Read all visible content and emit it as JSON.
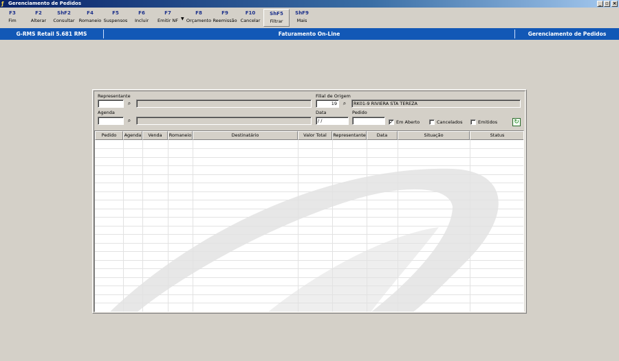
{
  "window": {
    "title": "Gerenciamento de Pedidos",
    "controls": {
      "minimize": "_",
      "maximize": "▫",
      "close": "×"
    }
  },
  "toolbar": {
    "buttons": [
      {
        "key": "F3",
        "label": "Fim"
      },
      {
        "key": "F2",
        "label": "Alterar"
      },
      {
        "key": "ShF2",
        "label": "Consultar"
      },
      {
        "key": "F4",
        "label": "Romaneio"
      },
      {
        "key": "F5",
        "label": "Suspensos"
      },
      {
        "key": "F6",
        "label": "Incluir"
      },
      {
        "key": "F7",
        "label": "Emitir NF"
      },
      {
        "key": "F8",
        "label": "Orçamento"
      },
      {
        "key": "F9",
        "label": "Reemissão"
      },
      {
        "key": "F10",
        "label": "Cancelar"
      },
      {
        "key": "ShF5",
        "label": "Filtrar"
      },
      {
        "key": "ShF9",
        "label": "Mais"
      }
    ]
  },
  "infobar": {
    "system": "G-RMS Retail 5.681 RMS",
    "module": "Faturamento On-Line",
    "screen": "Gerenciamento de Pedidos"
  },
  "filters": {
    "representante": {
      "label": "Representante",
      "code": "",
      "name": ""
    },
    "agenda": {
      "label": "Agenda",
      "code": "",
      "name": ""
    },
    "filial": {
      "label": "Filial de Origem",
      "code": "19",
      "name": "RK01-9 RIVIERA STA TEREZA"
    },
    "data": {
      "label": "Data",
      "value": " / /"
    },
    "pedido": {
      "label": "Pedido",
      "value": ""
    },
    "checkboxes": [
      {
        "label": "Em Aberto",
        "checked": true,
        "mark": "✓"
      },
      {
        "label": "Cancelados",
        "checked": false,
        "mark": ""
      },
      {
        "label": "Emitidos",
        "checked": false,
        "mark": ""
      }
    ]
  },
  "grid": {
    "columns": [
      "Pedido",
      "Agenda",
      "Venda",
      "Romaneio",
      "Destinatário",
      "Valor Total",
      "Representante",
      "Data",
      "Situação",
      "Status"
    ],
    "rows": []
  },
  "icons": {
    "app": "app-icon",
    "search": "binoculars-icon",
    "refresh": "refresh-icon"
  },
  "colors": {
    "titlebar": "#0a246a",
    "infobar": "#1258b6",
    "background": "#d4d0c8",
    "toolbar_key": "#1a2f8a"
  }
}
